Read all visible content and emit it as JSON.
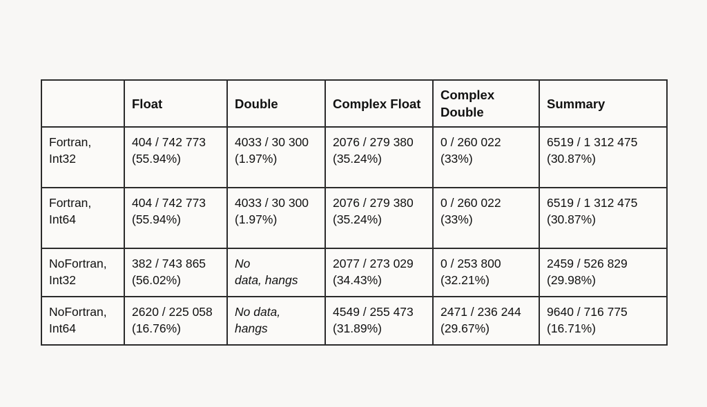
{
  "table": {
    "headers": [
      {
        "label": "",
        "name": "corner"
      },
      {
        "label": "Float",
        "name": "float"
      },
      {
        "label": "Double",
        "name": "double"
      },
      {
        "label": "Complex Float",
        "name": "complex-float"
      },
      {
        "label": "Complex\nDouble",
        "name": "complex-double"
      },
      {
        "label": "Summary",
        "name": "summary"
      }
    ],
    "rows": [
      {
        "label": "Fortran,\nInt32",
        "float": "404 / 742 773\n(55.94%)",
        "double": "4033 / 30 300\n(1.97%)",
        "complex_float": "2076 / 279 380\n(35.24%)",
        "complex_double": "0 / 260 022\n(33%)",
        "summary": "6519 / 1 312 475\n(30.87%)",
        "double_italic": false
      },
      {
        "label": "Fortran,\nInt64",
        "float": "404 / 742 773\n(55.94%)",
        "double": "4033 / 30 300\n(1.97%)",
        "complex_float": "2076 / 279 380\n(35.24%)",
        "complex_double": "0 / 260 022\n(33%)",
        "summary": "6519 / 1 312 475\n(30.87%)",
        "double_italic": false
      },
      {
        "label": "NoFortran,\nInt32",
        "float": "382 / 743 865\n(56.02%)",
        "double": "No\ndata, hangs",
        "complex_float": "2077 / 273 029\n(34.43%)",
        "complex_double": "0 / 253 800\n(32.21%)",
        "summary": "2459 / 526 829\n(29.98%)",
        "double_italic": true
      },
      {
        "label": "NoFortran,\nInt64",
        "float": "2620 / 225 058\n(16.76%)",
        "double": "No data,\nhangs",
        "complex_float": "4549 / 255 473\n(31.89%)",
        "complex_double": "2471 / 236 244\n(29.67%)",
        "summary": "9640 / 716 775\n(16.71%)",
        "double_italic": true
      }
    ]
  },
  "colors": {
    "background": "#f8f7f5",
    "cell_background": "#fbfaf8",
    "border": "#2b2b2b",
    "text": "#111111"
  }
}
